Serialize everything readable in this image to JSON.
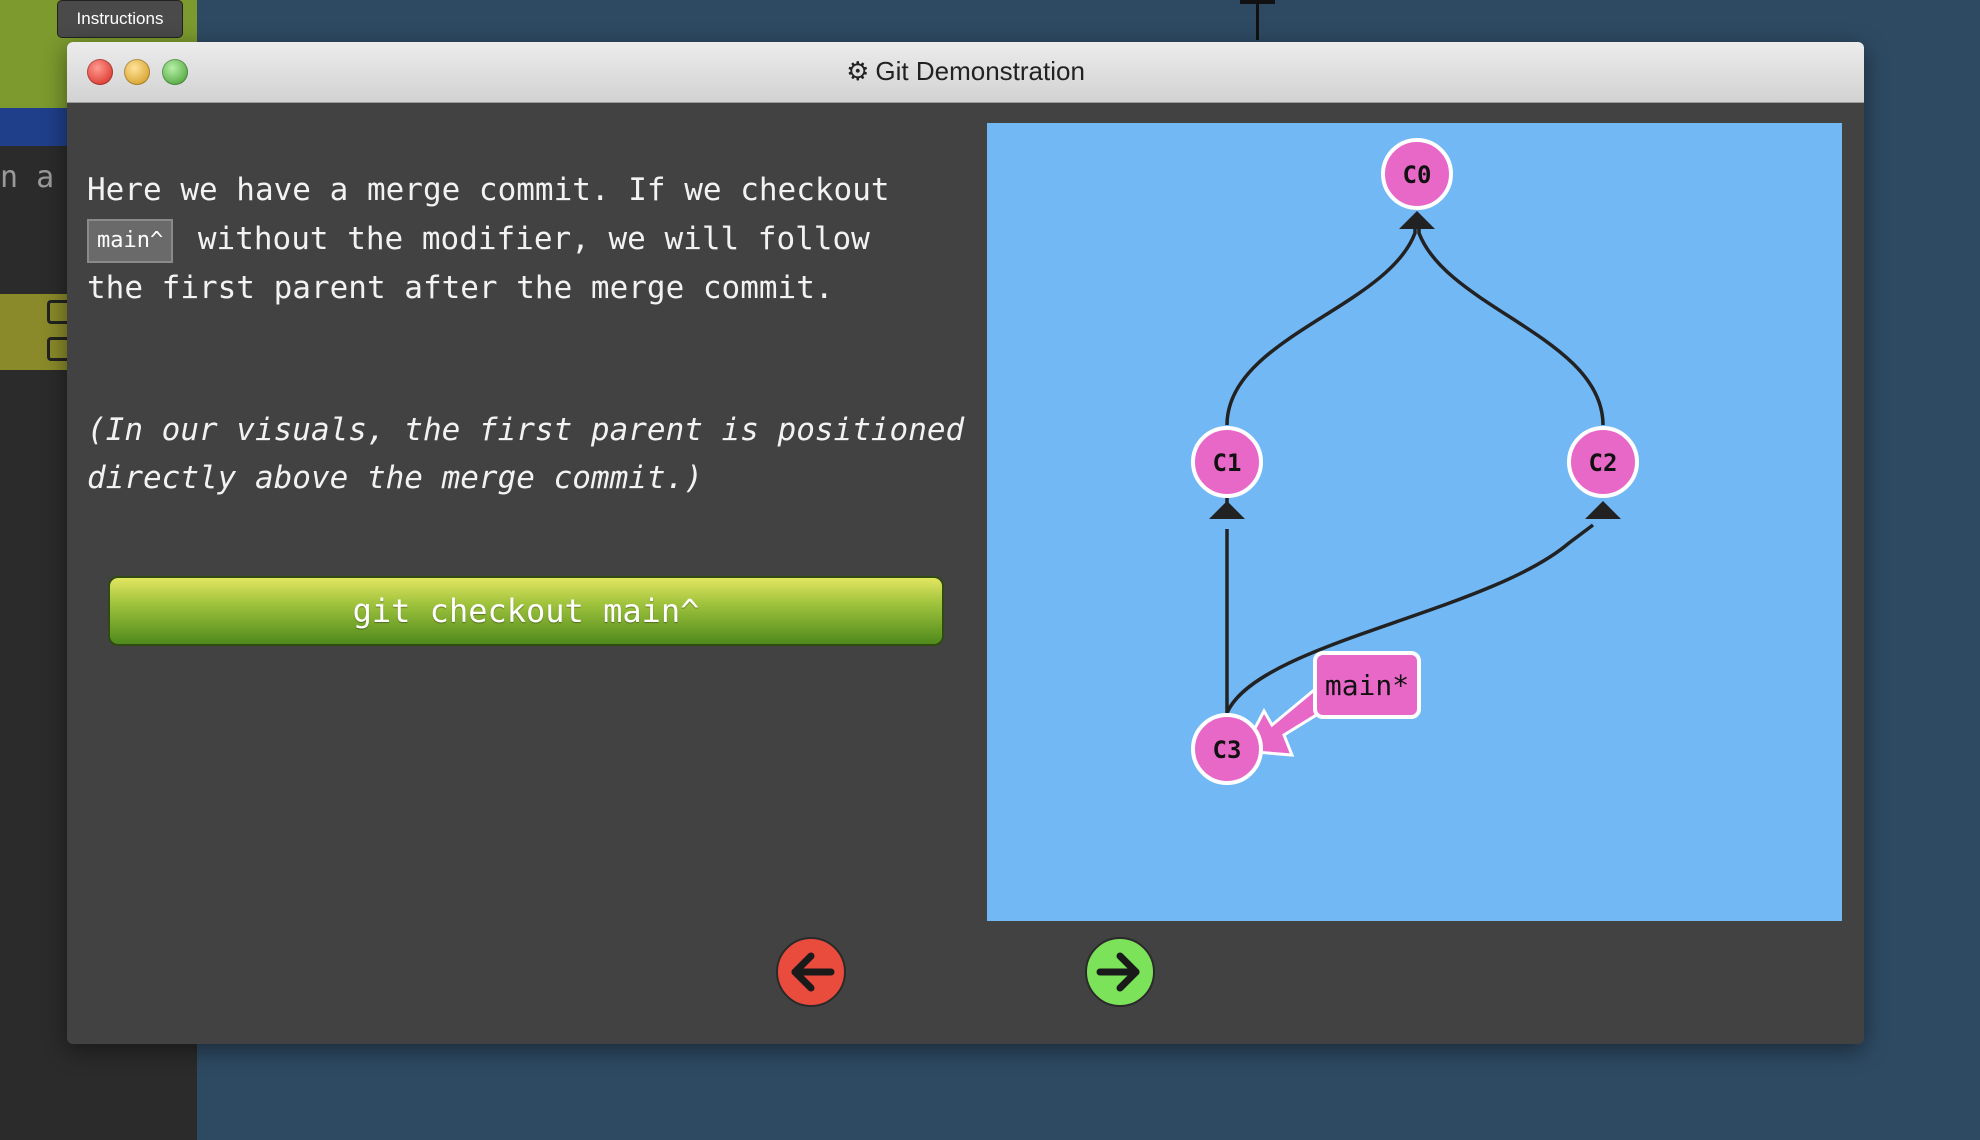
{
  "background": {
    "instructions_label": "Instructions",
    "left_snippet": "n a"
  },
  "window": {
    "title": "Git Demonstration",
    "title_icon": "gear-icon",
    "controls": [
      "close",
      "minimize",
      "zoom"
    ]
  },
  "dialog": {
    "text_before_code": "Here we have a merge commit. If we checkout",
    "inline_code": "main^",
    "text_after_code": " without the modifier, we will follow\nthe first parent after the merge commit.",
    "note": "(In our visuals, the first parent is positioned directly above the merge commit.)",
    "command_button": "git checkout main^"
  },
  "graph": {
    "background_color": "#72b8f5",
    "node_color": "#e868c8",
    "commits": [
      {
        "id": "C0"
      },
      {
        "id": "C1"
      },
      {
        "id": "C2"
      },
      {
        "id": "C3"
      }
    ],
    "edges": [
      {
        "from": "C1",
        "to": "C0"
      },
      {
        "from": "C2",
        "to": "C0"
      },
      {
        "from": "C3",
        "to": "C1"
      },
      {
        "from": "C3",
        "to": "C2"
      }
    ],
    "branch": {
      "label": "main*",
      "points_to": "C3"
    }
  },
  "navigation": {
    "back_icon": "arrow-left-icon",
    "back_color": "#e94b3c",
    "forward_icon": "arrow-right-icon",
    "forward_color": "#7be25a"
  }
}
